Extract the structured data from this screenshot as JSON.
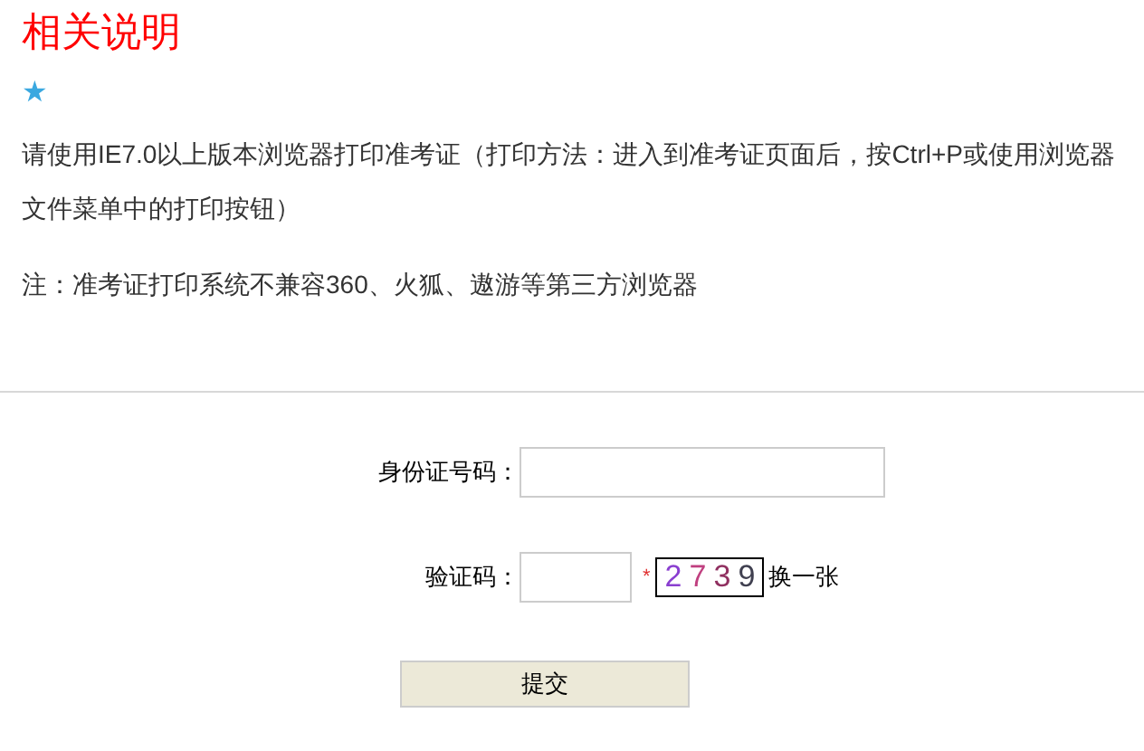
{
  "heading": "相关说明",
  "star": "★",
  "instructions": [
    "请使用IE7.0以上版本浏览器打印准考证（打印方法：进入到准考证页面后，按Ctrl+P或使用浏览器文件菜单中的打印按钮）",
    "注：准考证打印系统不兼容360、火狐、遨游等第三方浏览器"
  ],
  "form": {
    "id_label": "身份证号码：",
    "captcha_label": "验证码：",
    "required_mark": "*",
    "captcha_chars": [
      {
        "char": "2",
        "color": "#8a3fd0"
      },
      {
        "char": "7",
        "color": "#c04080"
      },
      {
        "char": "3",
        "color": "#903060"
      },
      {
        "char": "9",
        "color": "#404050"
      }
    ],
    "refresh_link": "换一张",
    "submit": "提交"
  }
}
